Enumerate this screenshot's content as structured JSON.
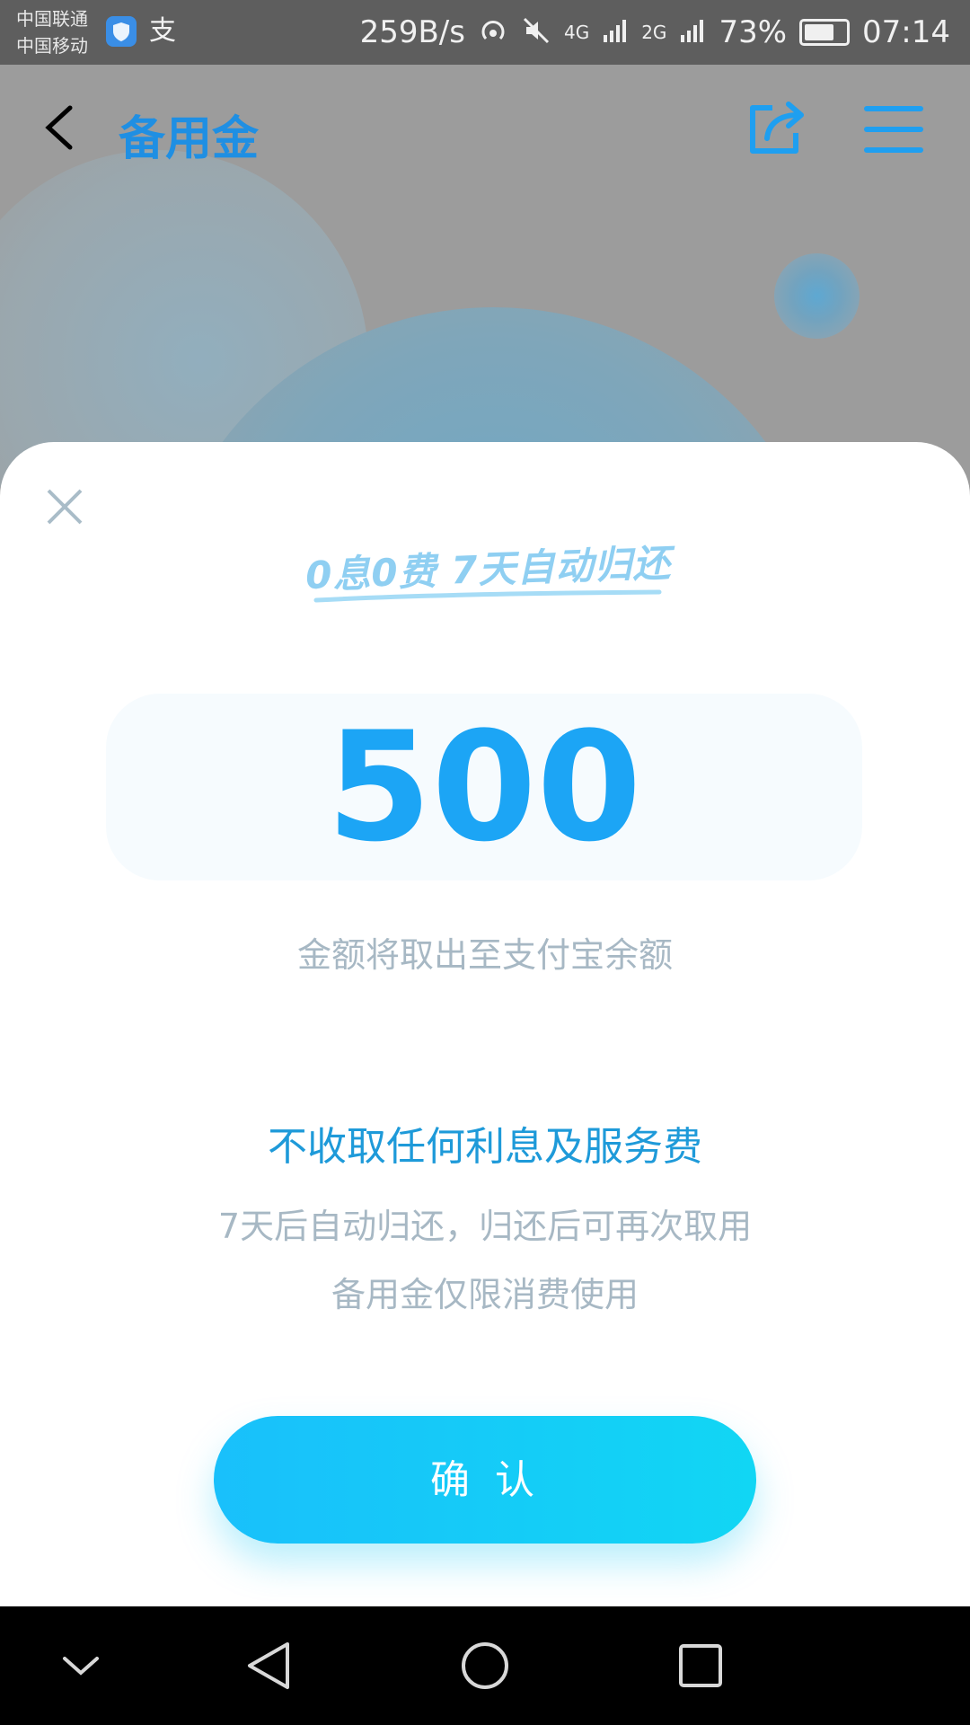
{
  "status_bar": {
    "carrier_1": "中国联通",
    "carrier_2": "中国移动",
    "alipay_icon_glyph": "支",
    "net_speed": "259B/s",
    "net_4g": "4G",
    "net_2g": "2G",
    "battery_text": "73%",
    "battery_level": 0.73,
    "time": "07:14"
  },
  "header": {
    "title": "备用金",
    "icons": [
      "back-arrow-icon",
      "share-icon",
      "menu-icon"
    ]
  },
  "card": {
    "slogan": "0息0费 7天自动归还",
    "amount": "500",
    "note": "金额将取出至支付宝余额",
    "headline": "不收取任何利息及服务费",
    "sub_line_1": "7天后自动归还，归还后可再次取用",
    "sub_line_2": "备用金仅限消费使用",
    "confirm_label": "确认"
  },
  "system_nav": {
    "icons": [
      "chevron-down-icon",
      "back-triangle-icon",
      "home-circle-icon",
      "recents-square-icon"
    ]
  },
  "colors": {
    "accent": "#1ca5f5",
    "title_blue": "#1f8fe3",
    "button_gradient_start": "#19c0fb",
    "button_gradient_end": "#11d6f4",
    "muted_text": "#a7b8c4"
  }
}
